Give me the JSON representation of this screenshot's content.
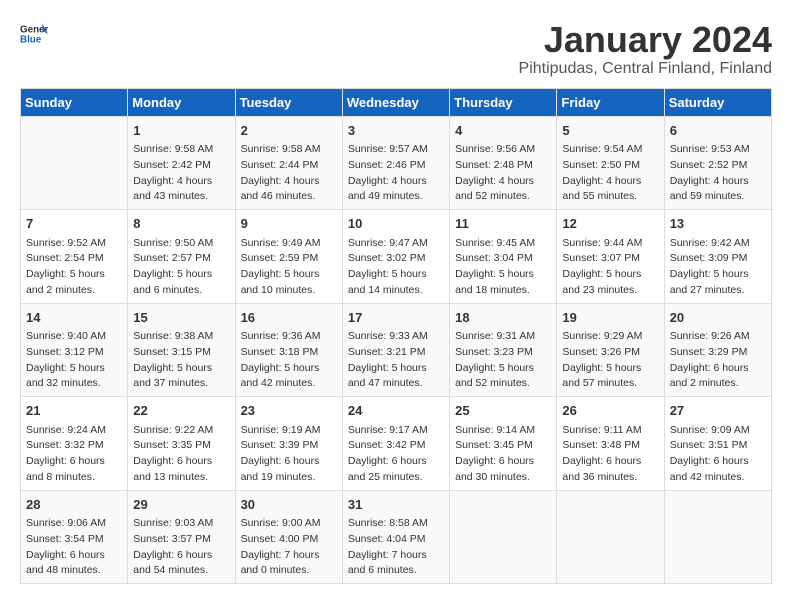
{
  "header": {
    "logo_line1": "General",
    "logo_line2": "Blue",
    "title": "January 2024",
    "subtitle": "Pihtipudas, Central Finland, Finland"
  },
  "days_of_week": [
    "Sunday",
    "Monday",
    "Tuesday",
    "Wednesday",
    "Thursday",
    "Friday",
    "Saturday"
  ],
  "weeks": [
    [
      {
        "day": "",
        "info": ""
      },
      {
        "day": "1",
        "info": "Sunrise: 9:58 AM\nSunset: 2:42 PM\nDaylight: 4 hours\nand 43 minutes."
      },
      {
        "day": "2",
        "info": "Sunrise: 9:58 AM\nSunset: 2:44 PM\nDaylight: 4 hours\nand 46 minutes."
      },
      {
        "day": "3",
        "info": "Sunrise: 9:57 AM\nSunset: 2:46 PM\nDaylight: 4 hours\nand 49 minutes."
      },
      {
        "day": "4",
        "info": "Sunrise: 9:56 AM\nSunset: 2:48 PM\nDaylight: 4 hours\nand 52 minutes."
      },
      {
        "day": "5",
        "info": "Sunrise: 9:54 AM\nSunset: 2:50 PM\nDaylight: 4 hours\nand 55 minutes."
      },
      {
        "day": "6",
        "info": "Sunrise: 9:53 AM\nSunset: 2:52 PM\nDaylight: 4 hours\nand 59 minutes."
      }
    ],
    [
      {
        "day": "7",
        "info": "Sunrise: 9:52 AM\nSunset: 2:54 PM\nDaylight: 5 hours\nand 2 minutes."
      },
      {
        "day": "8",
        "info": "Sunrise: 9:50 AM\nSunset: 2:57 PM\nDaylight: 5 hours\nand 6 minutes."
      },
      {
        "day": "9",
        "info": "Sunrise: 9:49 AM\nSunset: 2:59 PM\nDaylight: 5 hours\nand 10 minutes."
      },
      {
        "day": "10",
        "info": "Sunrise: 9:47 AM\nSunset: 3:02 PM\nDaylight: 5 hours\nand 14 minutes."
      },
      {
        "day": "11",
        "info": "Sunrise: 9:45 AM\nSunset: 3:04 PM\nDaylight: 5 hours\nand 18 minutes."
      },
      {
        "day": "12",
        "info": "Sunrise: 9:44 AM\nSunset: 3:07 PM\nDaylight: 5 hours\nand 23 minutes."
      },
      {
        "day": "13",
        "info": "Sunrise: 9:42 AM\nSunset: 3:09 PM\nDaylight: 5 hours\nand 27 minutes."
      }
    ],
    [
      {
        "day": "14",
        "info": "Sunrise: 9:40 AM\nSunset: 3:12 PM\nDaylight: 5 hours\nand 32 minutes."
      },
      {
        "day": "15",
        "info": "Sunrise: 9:38 AM\nSunset: 3:15 PM\nDaylight: 5 hours\nand 37 minutes."
      },
      {
        "day": "16",
        "info": "Sunrise: 9:36 AM\nSunset: 3:18 PM\nDaylight: 5 hours\nand 42 minutes."
      },
      {
        "day": "17",
        "info": "Sunrise: 9:33 AM\nSunset: 3:21 PM\nDaylight: 5 hours\nand 47 minutes."
      },
      {
        "day": "18",
        "info": "Sunrise: 9:31 AM\nSunset: 3:23 PM\nDaylight: 5 hours\nand 52 minutes."
      },
      {
        "day": "19",
        "info": "Sunrise: 9:29 AM\nSunset: 3:26 PM\nDaylight: 5 hours\nand 57 minutes."
      },
      {
        "day": "20",
        "info": "Sunrise: 9:26 AM\nSunset: 3:29 PM\nDaylight: 6 hours\nand 2 minutes."
      }
    ],
    [
      {
        "day": "21",
        "info": "Sunrise: 9:24 AM\nSunset: 3:32 PM\nDaylight: 6 hours\nand 8 minutes."
      },
      {
        "day": "22",
        "info": "Sunrise: 9:22 AM\nSunset: 3:35 PM\nDaylight: 6 hours\nand 13 minutes."
      },
      {
        "day": "23",
        "info": "Sunrise: 9:19 AM\nSunset: 3:39 PM\nDaylight: 6 hours\nand 19 minutes."
      },
      {
        "day": "24",
        "info": "Sunrise: 9:17 AM\nSunset: 3:42 PM\nDaylight: 6 hours\nand 25 minutes."
      },
      {
        "day": "25",
        "info": "Sunrise: 9:14 AM\nSunset: 3:45 PM\nDaylight: 6 hours\nand 30 minutes."
      },
      {
        "day": "26",
        "info": "Sunrise: 9:11 AM\nSunset: 3:48 PM\nDaylight: 6 hours\nand 36 minutes."
      },
      {
        "day": "27",
        "info": "Sunrise: 9:09 AM\nSunset: 3:51 PM\nDaylight: 6 hours\nand 42 minutes."
      }
    ],
    [
      {
        "day": "28",
        "info": "Sunrise: 9:06 AM\nSunset: 3:54 PM\nDaylight: 6 hours\nand 48 minutes."
      },
      {
        "day": "29",
        "info": "Sunrise: 9:03 AM\nSunset: 3:57 PM\nDaylight: 6 hours\nand 54 minutes."
      },
      {
        "day": "30",
        "info": "Sunrise: 9:00 AM\nSunset: 4:00 PM\nDaylight: 7 hours\nand 0 minutes."
      },
      {
        "day": "31",
        "info": "Sunrise: 8:58 AM\nSunset: 4:04 PM\nDaylight: 7 hours\nand 6 minutes."
      },
      {
        "day": "",
        "info": ""
      },
      {
        "day": "",
        "info": ""
      },
      {
        "day": "",
        "info": ""
      }
    ]
  ]
}
